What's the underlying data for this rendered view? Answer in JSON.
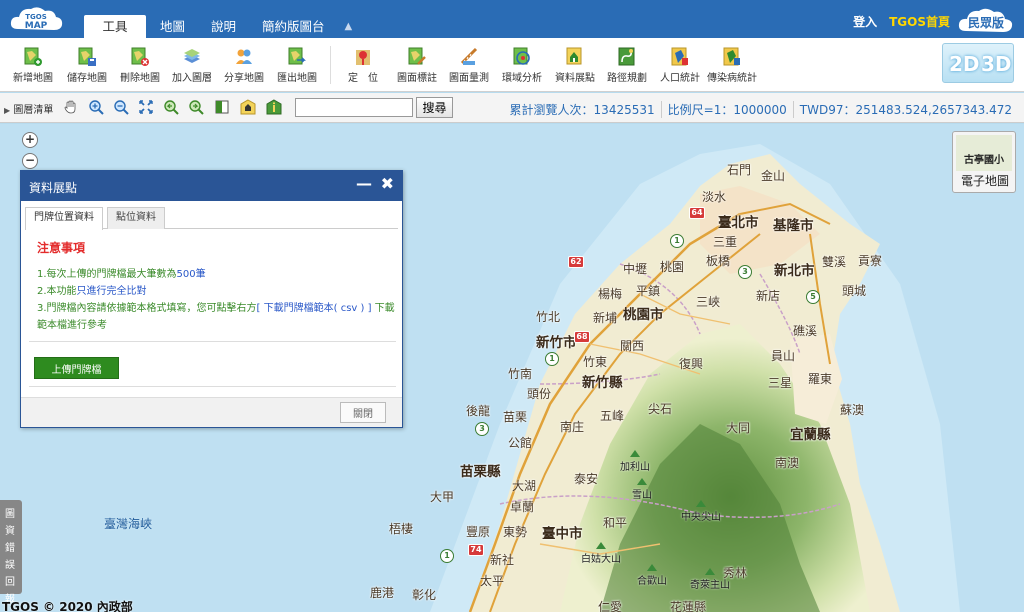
{
  "header": {
    "logo_text": "TGOS MAP",
    "tabs": [
      {
        "label": "工具"
      },
      {
        "label": "地圖"
      },
      {
        "label": "說明"
      },
      {
        "label": "簡約版圖台"
      }
    ],
    "login_label": "登入",
    "home_label": "TGOS首頁",
    "public_version_label": "民眾版",
    "colors": {
      "bar": "#2a6cb5",
      "home": "#ffd700"
    }
  },
  "toolbar": {
    "items": [
      {
        "label": "新增地圖",
        "icon": "new-map-icon"
      },
      {
        "label": "儲存地圖",
        "icon": "save-map-icon"
      },
      {
        "label": "刪除地圖",
        "icon": "delete-map-icon"
      },
      {
        "label": "加入圖層",
        "icon": "add-layer-icon"
      },
      {
        "label": "分享地圖",
        "icon": "share-map-icon"
      },
      {
        "label": "匯出地圖",
        "icon": "export-map-icon"
      },
      {
        "label": "定　位",
        "icon": "locate-icon"
      },
      {
        "label": "圖面標註",
        "icon": "annotate-icon"
      },
      {
        "label": "圖面量測",
        "icon": "measure-icon"
      },
      {
        "label": "環域分析",
        "icon": "buffer-analysis-icon"
      },
      {
        "label": "資料展點",
        "icon": "data-points-icon"
      },
      {
        "label": "路徑規劃",
        "icon": "route-planning-icon"
      },
      {
        "label": "人口統計",
        "icon": "population-stats-icon"
      },
      {
        "label": "傳染病統計",
        "icon": "epidemic-stats-icon"
      }
    ],
    "view_2d": "2D",
    "view_3d": "3D"
  },
  "subbar": {
    "layer_list_label": "圖層清單",
    "search_value": "",
    "search_button": "搜尋",
    "visits": "累計瀏覽人次：13425531",
    "scale": "比例尺=1：1000000",
    "coords": "TWD97：251483.524,2657343.472"
  },
  "map": {
    "emap_caption": "電子地圖",
    "emap_thumb_label": "古亭國小",
    "strait_label": "臺灣海峽",
    "error_report": "圖資錯誤回報",
    "copyright": "TGOS © 2020 內政部",
    "places": [
      {
        "name": "石門",
        "big": false
      },
      {
        "name": "金山",
        "big": false
      },
      {
        "name": "淡水",
        "big": false
      },
      {
        "name": "臺北市",
        "big": true
      },
      {
        "name": "基隆市",
        "big": true
      },
      {
        "name": "三重",
        "big": false
      },
      {
        "name": "中壢",
        "big": false
      },
      {
        "name": "桃園",
        "big": false
      },
      {
        "name": "板橋",
        "big": false
      },
      {
        "name": "新北市",
        "big": true
      },
      {
        "name": "雙溪",
        "big": false
      },
      {
        "name": "貢寮",
        "big": false
      },
      {
        "name": "楊梅",
        "big": false
      },
      {
        "name": "平鎮",
        "big": false
      },
      {
        "name": "三峽",
        "big": false
      },
      {
        "name": "新店",
        "big": false
      },
      {
        "name": "頭城",
        "big": false
      },
      {
        "name": "竹北",
        "big": false
      },
      {
        "name": "新埔",
        "big": false
      },
      {
        "name": "桃園市",
        "big": true
      },
      {
        "name": "礁溪",
        "big": false
      },
      {
        "name": "新竹市",
        "big": true
      },
      {
        "name": "關西",
        "big": false
      },
      {
        "name": "竹東",
        "big": false
      },
      {
        "name": "員山",
        "big": false
      },
      {
        "name": "復興",
        "big": false
      },
      {
        "name": "竹南",
        "big": false
      },
      {
        "name": "新竹縣",
        "big": true
      },
      {
        "name": "三星",
        "big": false
      },
      {
        "name": "羅東",
        "big": false
      },
      {
        "name": "頭份",
        "big": false
      },
      {
        "name": "後龍",
        "big": false
      },
      {
        "name": "苗栗",
        "big": false
      },
      {
        "name": "五峰",
        "big": false
      },
      {
        "name": "尖石",
        "big": false
      },
      {
        "name": "蘇澳",
        "big": false
      },
      {
        "name": "南庄",
        "big": false
      },
      {
        "name": "大同",
        "big": false
      },
      {
        "name": "宜蘭縣",
        "big": true
      },
      {
        "name": "公館",
        "big": false
      },
      {
        "name": "苗栗縣",
        "big": true
      },
      {
        "name": "南澳",
        "big": false
      },
      {
        "name": "大湖",
        "big": false
      },
      {
        "name": "泰安",
        "big": false
      },
      {
        "name": "大甲",
        "big": false
      },
      {
        "name": "卓蘭",
        "big": false
      },
      {
        "name": "梧棲",
        "big": false
      },
      {
        "name": "豐原",
        "big": false
      },
      {
        "name": "東勢",
        "big": false
      },
      {
        "name": "臺中市",
        "big": true
      },
      {
        "name": "和平",
        "big": false
      },
      {
        "name": "新社",
        "big": false
      },
      {
        "name": "太平",
        "big": false
      },
      {
        "name": "秀林",
        "big": false
      },
      {
        "name": "鹿港",
        "big": false
      },
      {
        "name": "彰化",
        "big": false
      },
      {
        "name": "仁愛",
        "big": false
      },
      {
        "name": "花蓮縣",
        "big": false
      }
    ],
    "peaks": [
      {
        "name": "加利山"
      },
      {
        "name": "雪山"
      },
      {
        "name": "中央尖山"
      },
      {
        "name": "白姑大山"
      },
      {
        "name": "合歡山"
      },
      {
        "name": "奇萊主山"
      }
    ],
    "highways": [
      "64",
      "1",
      "3",
      "5",
      "62",
      "68",
      "1",
      "3",
      "74",
      "1"
    ]
  },
  "dialog": {
    "title": "資料展點",
    "tabs": [
      {
        "label": "門牌位置資料"
      },
      {
        "label": "點位資料"
      }
    ],
    "notice_title": "注意事項",
    "line1_prefix": "1.每次上傳的門牌檔最大筆數為",
    "line1_value": "500筆",
    "line2_prefix": "2.本功能",
    "line2_value": "只進行完全比對",
    "line3_prefix": "3.門牌檔內容請依據範本格式填寫，您可點擊右方",
    "line3_link": "[ 下載門牌檔範本( csv ) ]",
    "line3_suffix": " 下載範本檔進行參考",
    "upload_button": "上傳門牌檔",
    "close_button": "關閉"
  }
}
